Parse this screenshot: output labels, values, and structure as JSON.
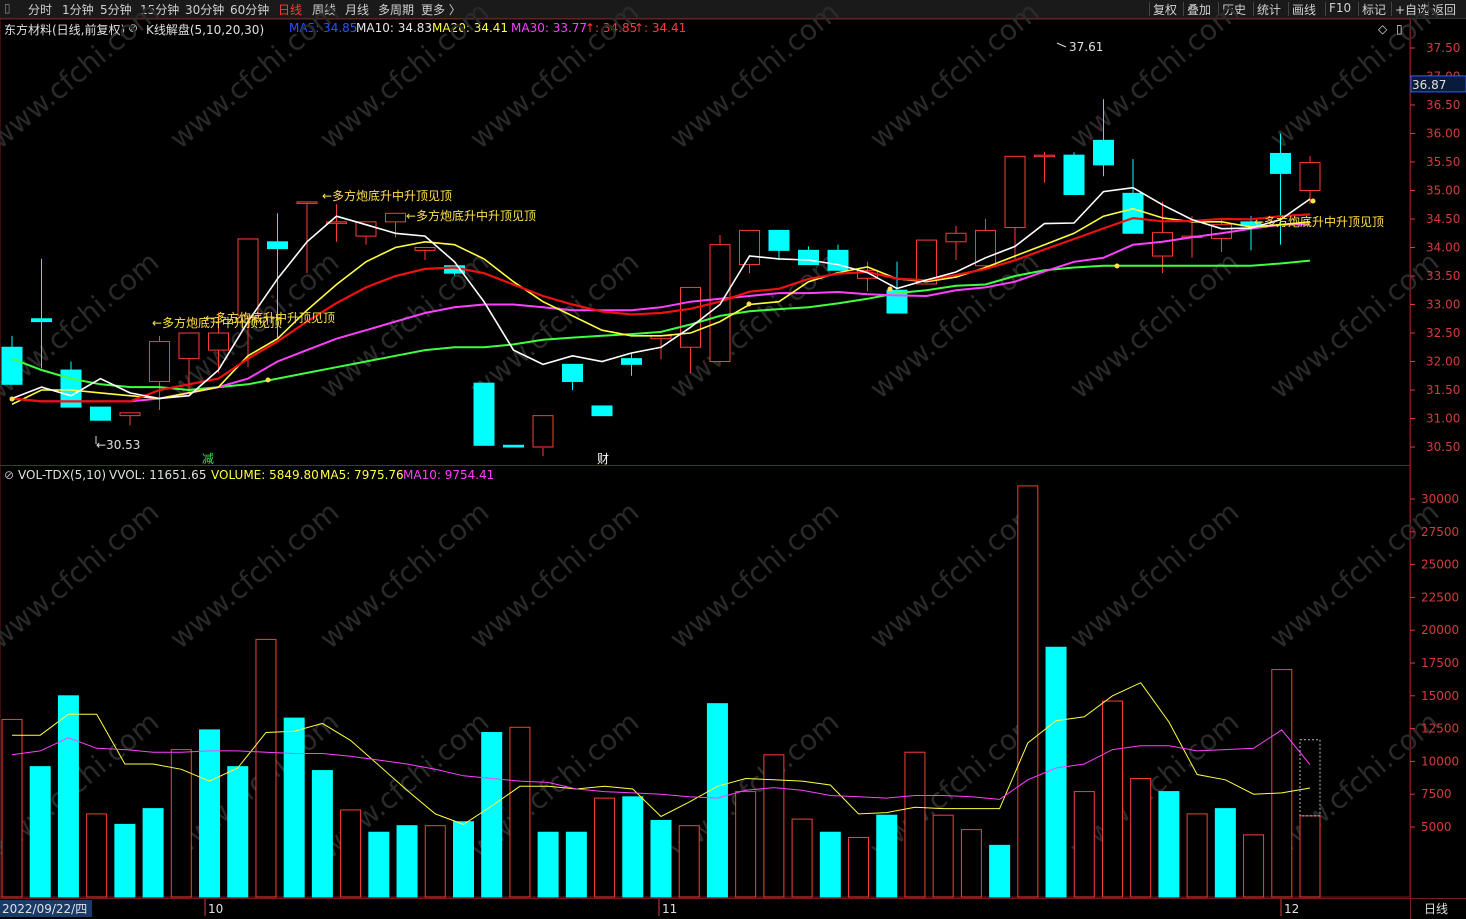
{
  "topbar": {
    "tabs": [
      "分时",
      "1分钟",
      "5分钟",
      "15分钟",
      "30分钟",
      "60分钟",
      "日线",
      "周线",
      "月线",
      "多周期",
      "更多 〉"
    ],
    "active_tab": "日线",
    "right_buttons": [
      "复权",
      "叠加",
      "历史",
      "统计",
      "画线",
      "F10",
      "标记",
      "+自选",
      "返回"
    ]
  },
  "header": {
    "stock_title": "东方材料(日线,前复权)",
    "indicator": "K线解盘(5,10,20,30)",
    "ma5": "MA5: 34.85",
    "ma10": "MA10: 34.83",
    "ma20": "MA20: 34.41",
    "ma30": "MA30: 33.77",
    "extra1": "↑: 34.85",
    "extra2": "↑: 34.41"
  },
  "volume_header": {
    "name": "VOL-TDX(5,10)",
    "vvol": "VVOL: 11651.65",
    "volume": "VOLUME: 5849.80",
    "ma5": "MA5: 7975.76",
    "ma10": "MA10: 9754.41"
  },
  "price_axis": {
    "current_price": "36.87",
    "ticks": [
      "37.50",
      "37.00",
      "36.50",
      "36.00",
      "35.50",
      "35.00",
      "34.50",
      "34.00",
      "33.50",
      "33.00",
      "32.50",
      "32.00",
      "31.50",
      "31.00",
      "30.50"
    ]
  },
  "volume_axis": {
    "ticks": [
      "30000",
      "27500",
      "25000",
      "22500",
      "20000",
      "17500",
      "15000",
      "12500",
      "10000",
      "7500",
      "5000"
    ]
  },
  "date_axis": {
    "start_date": "2022/09/22/四",
    "month_labels": [
      "10",
      "11",
      "12"
    ],
    "period": "日线"
  },
  "annotations": {
    "low_label": "←30.53",
    "high_label": "37.61",
    "signal_text": "←多方炮底升中升顶见顶",
    "reduce_mark": "减",
    "finance_mark": "财"
  },
  "colors": {
    "up": "#ff3b3b",
    "down": "#00ffff",
    "ma5": "#ffffff",
    "ma10": "#ffff40",
    "ma20": "#ff40ff",
    "ma30": "#40ff40",
    "axis": "#d43b3b",
    "trend": "#ee1111"
  },
  "chart_data": {
    "type": "candlestick",
    "series_open": [
      32.25,
      32.75,
      31.85,
      31.2,
      31.05,
      31.65,
      32.05,
      32.2,
      32.8,
      34.1,
      34.78,
      34.45,
      34.2,
      34.45,
      33.95,
      33.68,
      31.62,
      30.53,
      30.5,
      31.95,
      31.22,
      32.05,
      32.4,
      32.25,
      32.0,
      33.7,
      34.3,
      33.95,
      33.95,
      33.46,
      33.25,
      33.36,
      34.1,
      33.68,
      34.35,
      35.62,
      35.62,
      35.88,
      34.95,
      33.85,
      34.2,
      34.16,
      34.45,
      35.65,
      35.0
    ],
    "series_high": [
      32.45,
      33.8,
      32.0,
      31.2,
      31.05,
      32.45,
      32.05,
      32.86,
      33.3,
      34.6,
      34.78,
      34.76,
      34.45,
      34.45,
      33.95,
      33.68,
      31.62,
      30.53,
      30.48,
      31.95,
      31.22,
      32.15,
      32.45,
      32.4,
      34.22,
      34.0,
      34.22,
      34.02,
      34.05,
      33.75,
      33.75,
      33.5,
      34.38,
      34.5,
      34.68,
      35.68,
      35.67,
      36.6,
      35.55,
      34.8,
      34.55,
      34.5,
      34.55,
      36.0,
      35.6
    ],
    "series_low": [
      31.9,
      31.88,
      31.6,
      31.0,
      30.88,
      31.15,
      31.45,
      31.8,
      31.9,
      32.4,
      33.55,
      34.1,
      34.05,
      34.18,
      33.78,
      33.51,
      31.4,
      30.5,
      30.34,
      31.5,
      31.15,
      31.75,
      32.04,
      31.8,
      31.98,
      33.55,
      33.78,
      33.7,
      33.66,
      33.23,
      33.18,
      33.36,
      33.78,
      33.6,
      33.8,
      35.14,
      35.05,
      35.25,
      34.6,
      33.55,
      33.82,
      33.92,
      33.95,
      34.05,
      34.76
    ],
    "series_close": [
      31.6,
      32.7,
      31.2,
      30.97,
      31.1,
      32.35,
      32.5,
      32.5,
      34.15,
      33.98,
      34.8,
      34.45,
      34.45,
      34.6,
      34.0,
      33.55,
      30.53,
      30.5,
      31.05,
      31.65,
      31.05,
      31.95,
      32.45,
      33.3,
      34.05,
      34.3,
      33.95,
      33.7,
      33.6,
      33.6,
      32.85,
      34.13,
      34.25,
      34.3,
      35.6,
      35.62,
      34.93,
      35.45,
      34.25,
      34.26,
      34.2,
      34.4,
      34.38,
      35.3,
      35.49
    ],
    "ma5": [
      31.35,
      31.55,
      31.4,
      31.7,
      31.45,
      31.35,
      31.4,
      31.85,
      32.7,
      33.45,
      34.1,
      34.55,
      34.4,
      34.25,
      34.2,
      33.75,
      33.05,
      32.2,
      31.95,
      32.1,
      32.0,
      32.15,
      32.25,
      32.6,
      33.0,
      33.85,
      33.8,
      33.78,
      33.7,
      33.56,
      33.28,
      33.43,
      33.57,
      33.82,
      34.02,
      34.42,
      34.43,
      34.98,
      35.05,
      34.75,
      34.49,
      34.33,
      34.34,
      34.49,
      34.85
    ],
    "ma10": [
      31.25,
      31.5,
      31.5,
      31.45,
      31.4,
      31.35,
      31.45,
      31.55,
      32.1,
      32.4,
      32.9,
      33.35,
      33.75,
      34.0,
      34.1,
      34.05,
      33.8,
      33.4,
      33.05,
      32.8,
      32.55,
      32.45,
      32.45,
      32.5,
      32.7,
      33.0,
      33.05,
      33.4,
      33.56,
      33.66,
      33.45,
      33.4,
      33.48,
      33.65,
      33.85,
      34.05,
      34.25,
      34.55,
      34.68,
      34.52,
      34.45,
      34.45,
      34.36,
      34.4,
      34.45
    ],
    "ma20": [
      31.35,
      31.3,
      31.3,
      31.3,
      31.3,
      31.35,
      31.45,
      31.55,
      31.7,
      32.0,
      32.2,
      32.4,
      32.55,
      32.7,
      32.85,
      32.95,
      33.0,
      33.0,
      32.95,
      32.9,
      32.9,
      32.9,
      32.95,
      33.05,
      33.1,
      33.15,
      33.2,
      33.2,
      33.22,
      33.18,
      33.16,
      33.15,
      33.25,
      33.3,
      33.4,
      33.58,
      33.75,
      33.82,
      34.05,
      34.1,
      34.18,
      34.25,
      34.33,
      34.4,
      34.41
    ],
    "ma30": [
      32.05,
      31.85,
      31.7,
      31.6,
      31.55,
      31.55,
      31.5,
      31.55,
      31.6,
      31.7,
      31.8,
      31.9,
      32.0,
      32.1,
      32.2,
      32.25,
      32.25,
      32.3,
      32.38,
      32.42,
      32.45,
      32.48,
      32.52,
      32.65,
      32.8,
      32.88,
      32.92,
      32.95,
      33.02,
      33.1,
      33.2,
      33.25,
      33.33,
      33.35,
      33.5,
      33.6,
      33.65,
      33.68,
      33.68,
      33.68,
      33.68,
      33.68,
      33.68,
      33.72,
      33.77
    ],
    "volume": [
      13200,
      9600,
      15000,
      6000,
      5200,
      6400,
      10900,
      12400,
      9600,
      19300,
      13300,
      9300,
      6300,
      4600,
      5100,
      5100,
      5400,
      12200,
      12600,
      4600,
      4600,
      7200,
      7300,
      5500,
      5100,
      14400,
      7700,
      10500,
      5600,
      4600,
      4200,
      5900,
      10700,
      5900,
      4800,
      3600,
      31000,
      18700,
      7700,
      14600,
      8700,
      7700,
      6000,
      6400,
      4400,
      17000,
      5850
    ],
    "vol_ma5": [
      12000,
      12000,
      13600,
      13600,
      9800,
      9800,
      9400,
      8500,
      9500,
      12200,
      12300,
      12900,
      11600,
      9700,
      7800,
      6000,
      5200,
      6600,
      8100,
      8100,
      7900,
      8100,
      7900,
      5800,
      6900,
      8100,
      8700,
      8600,
      8500,
      8200,
      6000,
      6100,
      6500,
      6400,
      6400,
      6400,
      11400,
      13100,
      13400,
      15000,
      16000,
      13000,
      9000,
      8600,
      7500,
      7600,
      7976
    ],
    "vol_ma10": [
      10500,
      10800,
      11800,
      11000,
      10900,
      10700,
      10700,
      10800,
      10800,
      10700,
      10600,
      10600,
      10400,
      10100,
      9800,
      9400,
      8900,
      8700,
      8500,
      8400,
      7900,
      7700,
      7600,
      7500,
      7300,
      7200,
      7800,
      8000,
      7800,
      7400,
      7300,
      7200,
      7400,
      7400,
      7300,
      7100,
      8600,
      9500,
      9800,
      10900,
      11200,
      11200,
      10800,
      10900,
      11000,
      12400,
      9754
    ],
    "xlabel": "",
    "ylabel": "",
    "ylim": [
      30.25,
      37.8
    ]
  }
}
